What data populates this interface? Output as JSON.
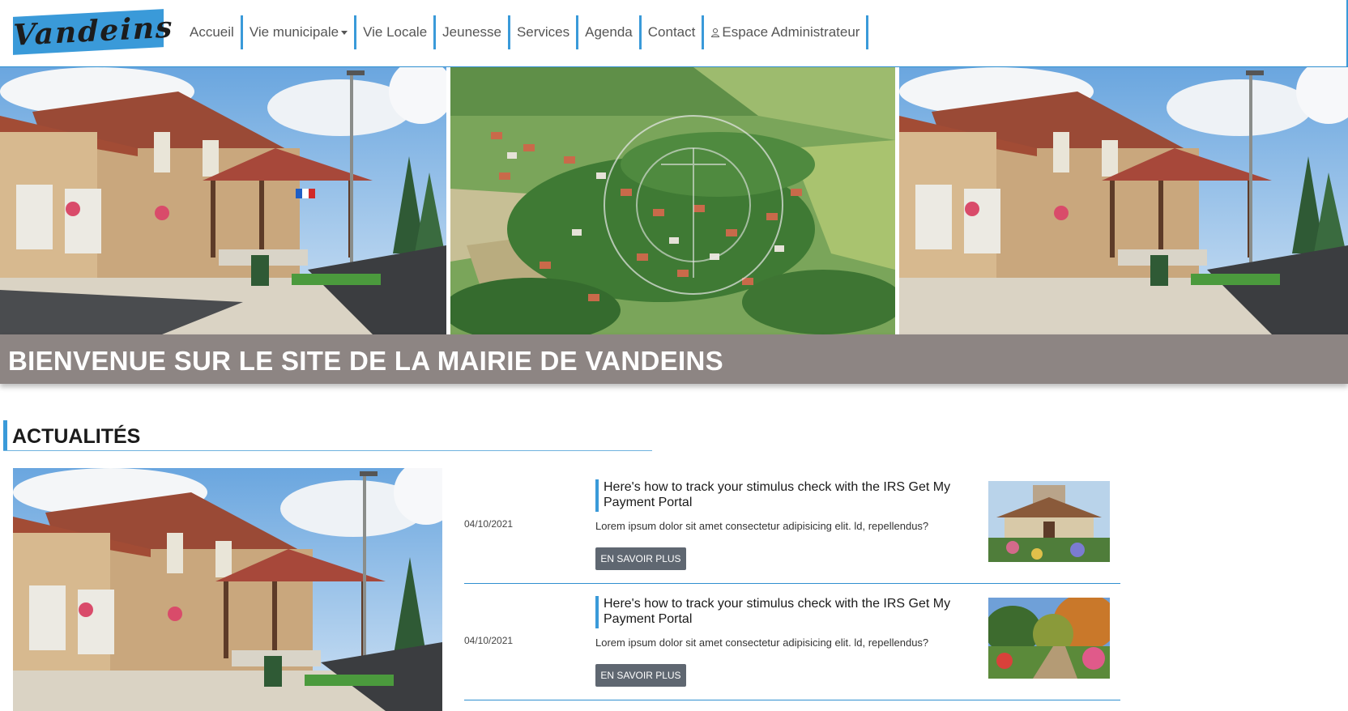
{
  "site": {
    "logo_text": "Vandeins"
  },
  "nav": {
    "items": [
      {
        "label": "Accueil"
      },
      {
        "label": "Vie municipale"
      },
      {
        "label": "Vie Locale"
      },
      {
        "label": "Jeunesse"
      },
      {
        "label": "Services"
      },
      {
        "label": "Agenda"
      },
      {
        "label": "Contact"
      },
      {
        "label": "Espace Administrateur"
      }
    ]
  },
  "hero": {
    "title": "BIENVENUE SUR LE SITE DE LA MAIRIE DE VANDEINS"
  },
  "news_section": {
    "title": "ACTUALITÉS",
    "items": [
      {
        "date": "04/10/2021",
        "title": "Here's how to track your stimulus check with the IRS Get My Payment Portal",
        "excerpt": "Lorem ipsum dolor sit amet consectetur adipisicing elit. ld, repellendus?",
        "button": "EN SAVOIR PLUS"
      },
      {
        "date": "04/10/2021",
        "title": "Here's how to track your stimulus check with the IRS Get My Payment Portal",
        "excerpt": "Lorem ipsum dolor sit amet consectetur adipisicing elit. ld, repellendus?",
        "button": "EN SAVOIR PLUS"
      }
    ]
  },
  "colors": {
    "accent": "#3a9ad9",
    "hero_band": "#8d8583",
    "button": "#5f6771"
  }
}
